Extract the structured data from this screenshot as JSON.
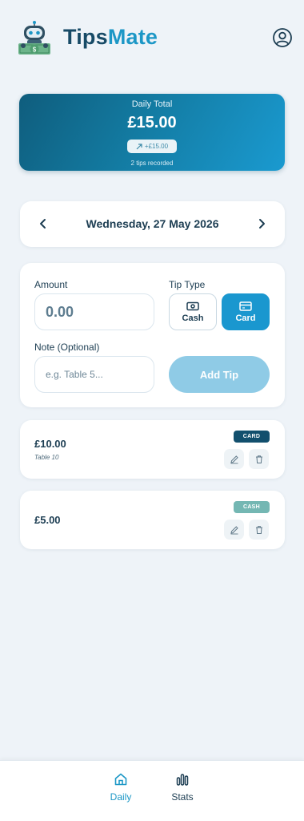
{
  "brand": {
    "part1": "Tips",
    "part2": "Mate"
  },
  "summary": {
    "label": "Daily Total",
    "amount": "£15.00",
    "change": "+£15.00",
    "count_text": "2 tips recorded"
  },
  "date_nav": {
    "date": "Wednesday, 27 May 2026"
  },
  "form": {
    "amount_label": "Amount",
    "amount_placeholder": "0.00",
    "tip_type_label": "Tip Type",
    "type_options": [
      "Cash",
      "Card"
    ],
    "selected_type": "Card",
    "note_label": "Note (Optional)",
    "note_placeholder": "e.g. Table 5...",
    "submit_label": "Add Tip"
  },
  "tips": [
    {
      "amount": "£10.00",
      "note": "Table 10",
      "type": "CARD"
    },
    {
      "amount": "£5.00",
      "note": "",
      "type": "CASH"
    }
  ],
  "bottom_nav": {
    "items": [
      "Daily",
      "Stats"
    ],
    "active": "Daily"
  },
  "colors": {
    "accent": "#1c97c6",
    "brand_dark": "#174a66",
    "card_badge": "#124f6d",
    "cash_badge": "#74b7b3"
  }
}
